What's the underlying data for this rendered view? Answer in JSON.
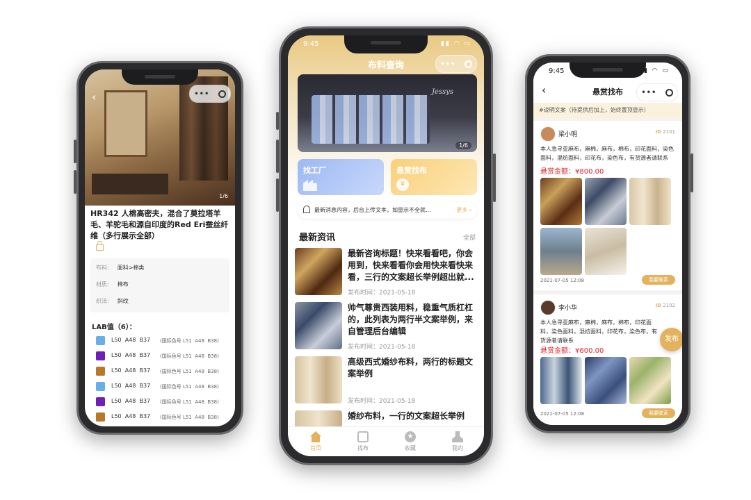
{
  "colors": {
    "accent": "#e3b25d",
    "price": "#e0242a",
    "card_blue": "#a8c2f5",
    "card_yellow": "#fcd98c"
  },
  "left_phone": {
    "status_time": "",
    "banner_counter": "1/6",
    "title": "HR342 人棉高密夫，混合了莫拉塔羊毛、羊驼毛和源自印度的Red Eri蚕丝纤维（多行展示全部）",
    "lock_icon": "lock-icon",
    "specs": [
      {
        "label": "布料:",
        "value": "面料>棉类"
      },
      {
        "label": "材质:",
        "value": "棉布"
      },
      {
        "label": "织法:",
        "value": "斜纹"
      }
    ],
    "lab_title": "LAB值（6）：",
    "lab_rows": [
      {
        "color": "#6aaee8",
        "value": "L50  A48  B37",
        "note": "(国际色号 L51  A48  B38)"
      },
      {
        "color": "#6b20b8",
        "value": "L50  A48  B37",
        "note": "(国际色号 L51  A48  B38)"
      },
      {
        "color": "#b9772a",
        "value": "L50  A48  B37",
        "note": "(国际色号 L51  A48  B38)"
      },
      {
        "color": "#6aaee8",
        "value": "L50  A48  B37",
        "note": "(国际色号 L51  A48  B38)"
      },
      {
        "color": "#6b20b8",
        "value": "L50  A48  B37",
        "note": "(国际色号 L51  A48  B38)"
      },
      {
        "color": "#b9772a",
        "value": "L50  A48  B37",
        "note": "(国际色号 L51  A48  B38)"
      }
    ]
  },
  "center_phone": {
    "status_time": "9:45",
    "nav_title": "布料查询",
    "banner_counter": "1/6",
    "banner_brand": "Jessys",
    "card_factory": "找工厂",
    "card_bounty": "悬赏找布",
    "notice_text": "最新消息内容，后台上传文本，如显示不全就...",
    "notice_more": "更多",
    "news_section": "最新资讯",
    "news_all": "全部",
    "news": [
      {
        "title": "最新咨询标题！快来看看吧，你会用到，快来看看你会用快来看快来看，三行的文案超长举例超出就...",
        "date": "发布时间：2021-05-18"
      },
      {
        "title": "帅气尊贵西装用料，稳重气质杠杠的，此列表为两行半文案举例，来自管理后台编辑",
        "date": "发布时间：2021-05-18"
      },
      {
        "title": "高级西式婚纱布料，两行的标题文案举例",
        "date": "发布时间：2021-05-18"
      },
      {
        "title": "婚纱布料，一行的文案超长举例",
        "date": ""
      }
    ],
    "tabs": [
      {
        "label": "首页",
        "icon": "home-icon"
      },
      {
        "label": "找布",
        "icon": "search-fabric-icon"
      },
      {
        "label": "收藏",
        "icon": "star-icon"
      },
      {
        "label": "我的",
        "icon": "user-icon"
      }
    ]
  },
  "right_phone": {
    "status_time": "9:45",
    "nav_title": "悬赏找布",
    "explain": "#说明文案（待提供后加上，始终置顶显示）",
    "publish_button": "发布",
    "posts": [
      {
        "user": "梁小明",
        "id_label": "ID",
        "id": "2101",
        "text": "本人急寻亚麻布，麻棉，麻布，棉布，印花面料，染色面料，混纺面料，印花布，染色布，有货源者请联系",
        "reward_label": "悬赏金额：",
        "reward": "¥800.00",
        "time": "2021-07-05 12:08",
        "contact": "我要联系"
      },
      {
        "user": "李小华",
        "id_label": "ID",
        "id": "2102",
        "text": "本人急寻亚麻布，麻棉，麻布，棉布，印花面料，染色面料，混纺面料，印花布，染色布，有货源者请联系",
        "reward_label": "悬赏金额：",
        "reward": "¥600.00",
        "time": "2021-07-05 12:08",
        "contact": "我要联系"
      }
    ]
  }
}
